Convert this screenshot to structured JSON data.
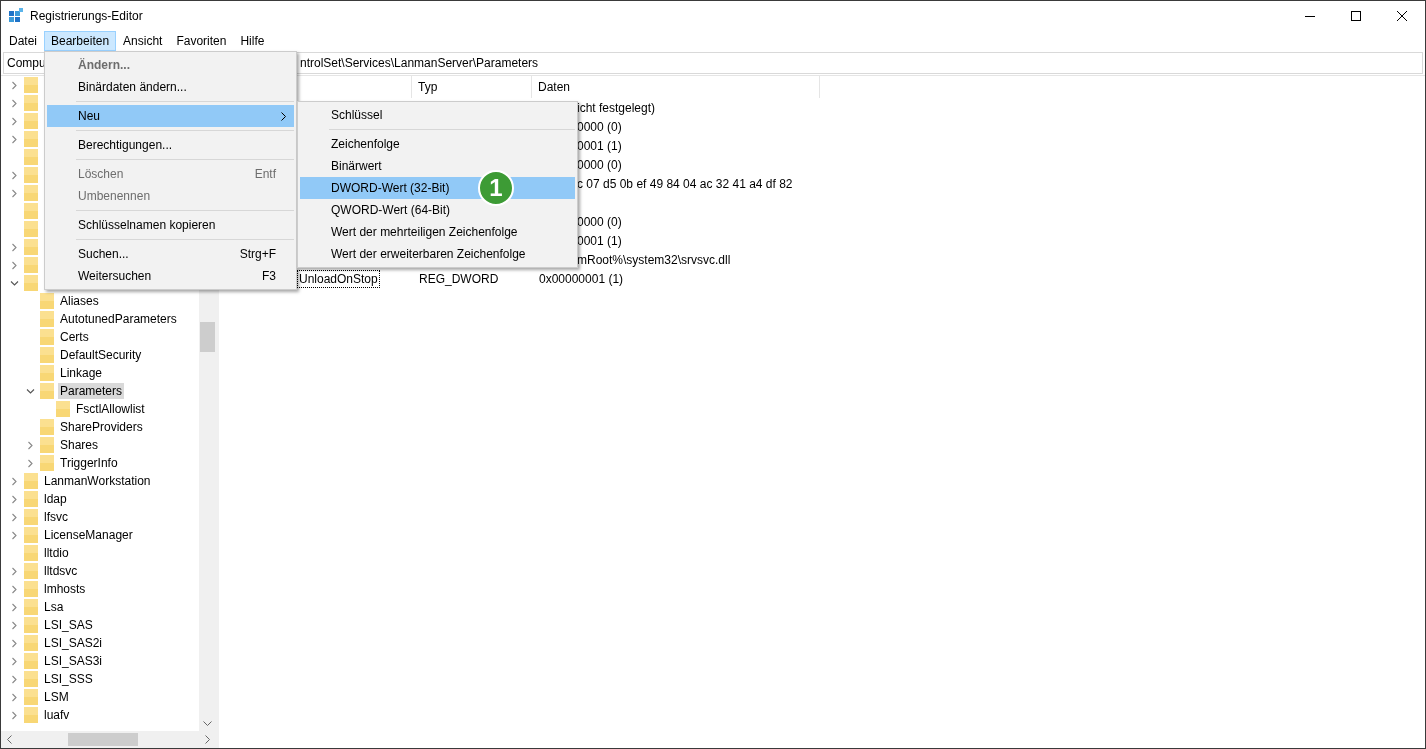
{
  "window": {
    "title": "Registrierungs-Editor"
  },
  "menubar": [
    {
      "label": "Datei",
      "selected": false
    },
    {
      "label": "Bearbeiten",
      "selected": true
    },
    {
      "label": "Ansicht",
      "selected": false
    },
    {
      "label": "Favoriten",
      "selected": false
    },
    {
      "label": "Hilfe",
      "selected": false
    }
  ],
  "address": {
    "start": "Compu",
    "end": "ntrolSet\\Services\\LanmanServer\\Parameters"
  },
  "tree": [
    {
      "expanded": false,
      "selected": false
    },
    {
      "expanded": false,
      "selected": false
    },
    {
      "expanded": false,
      "selected": false
    },
    {
      "expanded": false,
      "selected": false
    },
    {
      "selected": false
    },
    {
      "expanded": false,
      "selected": false
    },
    {
      "expanded": false,
      "selected": false
    },
    {
      "selected": false
    },
    {
      "selected": false
    },
    {
      "expanded": false,
      "selected": false
    },
    {
      "expanded": false,
      "selected": false
    },
    {
      "expanded": true,
      "selected": false,
      "children": [
        {
          "label": "Aliases",
          "selected": false
        },
        {
          "label": "AutotunedParameters",
          "selected": false
        },
        {
          "label": "Certs",
          "selected": false
        },
        {
          "label": "DefaultSecurity",
          "selected": false
        },
        {
          "label": "Linkage",
          "selected": false
        },
        {
          "label": "Parameters",
          "expanded": true,
          "selected": true,
          "children": [
            {
              "label": "FsctlAllowlist",
              "selected": false
            }
          ]
        },
        {
          "label": "ShareProviders",
          "selected": false
        },
        {
          "label": "Shares",
          "expanded": false,
          "selected": false
        },
        {
          "label": "TriggerInfo",
          "expanded": false,
          "selected": false
        }
      ]
    },
    {
      "label": "LanmanWorkstation",
      "expanded": false,
      "selected": false
    },
    {
      "label": "ldap",
      "expanded": false,
      "selected": false
    },
    {
      "label": "lfsvc",
      "expanded": false,
      "selected": false
    },
    {
      "label": "LicenseManager",
      "expanded": false,
      "selected": false
    },
    {
      "label": "lltdio",
      "selected": false
    },
    {
      "label": "lltdsvc",
      "expanded": false,
      "selected": false
    },
    {
      "label": "lmhosts",
      "expanded": false,
      "selected": false
    },
    {
      "label": "Lsa",
      "expanded": false,
      "selected": false
    },
    {
      "label": "LSI_SAS",
      "expanded": false,
      "selected": false
    },
    {
      "label": "LSI_SAS2i",
      "expanded": false,
      "selected": false
    },
    {
      "label": "LSI_SAS3i",
      "expanded": false,
      "selected": false
    },
    {
      "label": "LSI_SSS",
      "expanded": false,
      "selected": false
    },
    {
      "label": "LSM",
      "expanded": false,
      "selected": false
    },
    {
      "label": "luafv",
      "expanded": false,
      "selected": false
    }
  ],
  "list": {
    "columns": [
      "Typ",
      "Daten"
    ],
    "rows": [
      {
        "data": "icht festgelegt)"
      },
      {
        "data": "0000 (0)"
      },
      {
        "data": "0001 (1)"
      },
      {
        "data": "0000 (0)"
      },
      {
        "data": "c 07 d5 0b ef 49 84 04 ac 32 41 a4 df 82"
      },
      {},
      {
        "data": "0000 (0)"
      },
      {
        "data": "0001 (1)"
      },
      {
        "data": "mRoot%\\system32\\srvsvc.dll"
      },
      {
        "name": "UnloadOnStop",
        "type": "REG_DWORD",
        "data": "0x00000001 (1)"
      }
    ]
  },
  "edit_menu": [
    {
      "kind": "item",
      "label": "Ändern...",
      "default": true,
      "disabled": true,
      "selected": false
    },
    {
      "kind": "item",
      "label": "Binärdaten ändern...",
      "default": false,
      "disabled": false,
      "selected": false
    },
    {
      "kind": "separator"
    },
    {
      "kind": "submenu",
      "label": "Neu",
      "default": false,
      "disabled": false,
      "selected": true
    },
    {
      "kind": "separator"
    },
    {
      "kind": "item",
      "label": "Berechtigungen...",
      "default": false,
      "disabled": false,
      "selected": false
    },
    {
      "kind": "separator"
    },
    {
      "kind": "item",
      "label": "Löschen",
      "shortcut": "Entf",
      "default": false,
      "disabled": true,
      "selected": false
    },
    {
      "kind": "item",
      "label": "Umbenennen",
      "default": false,
      "disabled": true,
      "selected": false
    },
    {
      "kind": "separator"
    },
    {
      "kind": "item",
      "label": "Schlüsselnamen kopieren",
      "default": false,
      "disabled": false,
      "selected": false
    },
    {
      "kind": "separator"
    },
    {
      "kind": "item",
      "label": "Suchen...",
      "shortcut": "Strg+F",
      "default": false,
      "disabled": false,
      "selected": false
    },
    {
      "kind": "item",
      "label": "Weitersuchen",
      "shortcut": "F3",
      "default": false,
      "disabled": false,
      "selected": false
    }
  ],
  "new_submenu": [
    {
      "kind": "item",
      "label": "Schlüssel",
      "selected": false
    },
    {
      "kind": "separator"
    },
    {
      "kind": "item",
      "label": "Zeichenfolge",
      "selected": false
    },
    {
      "kind": "item",
      "label": "Binärwert",
      "selected": false
    },
    {
      "kind": "item",
      "label": "DWORD-Wert (32-Bit)",
      "selected": true,
      "callout": "1"
    },
    {
      "kind": "item",
      "label": "QWORD-Wert (64-Bit)",
      "selected": false
    },
    {
      "kind": "item",
      "label": "Wert der mehrteiligen Zeichenfolge",
      "selected": false
    },
    {
      "kind": "item",
      "label": "Wert der erweiterbaren Zeichenfolge",
      "selected": false
    }
  ]
}
